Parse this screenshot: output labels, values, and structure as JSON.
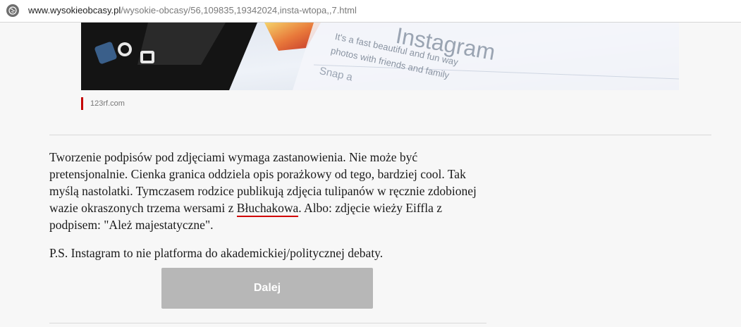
{
  "browser": {
    "url_host": "www.wysokieobcasy.pl",
    "url_path": "/wysokie-obcasy/56,109835,19342024,insta-wtopa,,7.html",
    "site_icon": "page-info-icon"
  },
  "photo": {
    "overlay_title": "Instagram",
    "overlay_line1": "It's a fast beautiful and fun way",
    "overlay_line2": "photos with friends and family",
    "overlay_line3": "Snap a",
    "credit": "123rf.com"
  },
  "article": {
    "paragraph1_before": "Tworzenie podpisów pod zdjęciami wymaga zastanowienia. Nie może być pretensjonalnie. Cienka granica oddziela opis porażkowy od tego, bardziej cool. Tak myślą nastolatki. Tymczasem rodzice publikują zdjęcia tulipanów w ręcznie zdobionej wazie okraszonych trzema wersami z ",
    "paragraph1_link": "Błuchakowa",
    "paragraph1_after": ". Albo: zdjęcie wieży Eiffla z podpisem: \"Ależ majestatyczne\".",
    "paragraph2": "P.S. Instagram to nie platforma do akademickiej/politycznej debaty."
  },
  "next_button": {
    "label": "Dalej"
  },
  "colors": {
    "accent_red": "#d10000",
    "button_gray": "#b7b7b7",
    "background": "#f7f7f7"
  }
}
